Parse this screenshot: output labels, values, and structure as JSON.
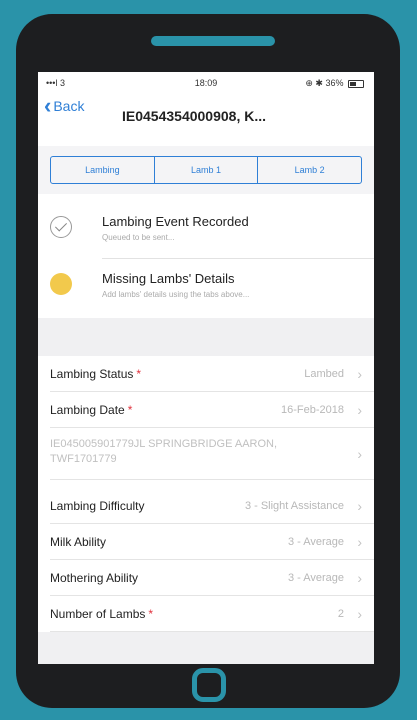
{
  "status_bar": {
    "signal": "•••l 3",
    "time": "18:09",
    "right": "⊕ ✱ 36%"
  },
  "nav": {
    "back_label": "Back",
    "title": "IE0454354000908, K..."
  },
  "tabs": [
    {
      "label": "Lambing"
    },
    {
      "label": "Lamb 1"
    },
    {
      "label": "Lamb 2"
    }
  ],
  "notices": [
    {
      "title": "Lambing Event Recorded",
      "subtitle": "Queued to be sent...",
      "icon": "checkmark-icon"
    },
    {
      "title": "Missing Lambs' Details",
      "subtitle": "Add lambs' details using the tabs above...",
      "icon": "warning-icon"
    }
  ],
  "fields": {
    "lambing_status": {
      "label": "Lambing Status",
      "required": "*",
      "value": "Lambed"
    },
    "lambing_date": {
      "label": "Lambing Date",
      "required": "*",
      "value": "16-Feb-2018"
    },
    "sire": {
      "value": "IE045005901779JL SPRINGBRIDGE AARON, TWF1701779"
    },
    "lambing_difficulty": {
      "label": "Lambing Difficulty",
      "value": "3 - Slight Assistance"
    },
    "milk_ability": {
      "label": "Milk Ability",
      "value": "3 - Average"
    },
    "mothering_ability": {
      "label": "Mothering Ability",
      "value": "3 - Average"
    },
    "number_of_lambs": {
      "label": "Number of Lambs",
      "required": "*",
      "value": "2"
    }
  },
  "colors": {
    "background": "#2a93a9",
    "accent": "#2f7fd6",
    "required": "#e0313c",
    "warning": "#f2c94c"
  }
}
